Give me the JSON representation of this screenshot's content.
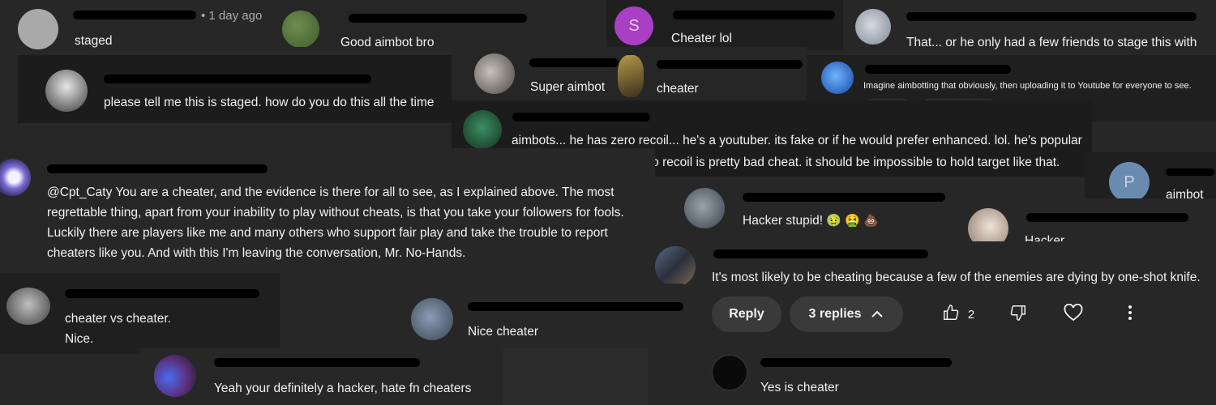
{
  "comments": [
    {
      "id": "c1",
      "meta": "• 1 day ago",
      "text": "staged"
    },
    {
      "id": "c2",
      "text": "Good aimbot bro"
    },
    {
      "id": "c3",
      "avatar_letter": "S",
      "text": "Cheater lol"
    },
    {
      "id": "c4",
      "text": "That... or he only had a few friends to stage this with"
    },
    {
      "id": "c5",
      "text": "please tell me this is staged. how do you do this all the time"
    },
    {
      "id": "c6",
      "text": "Super aimbot"
    },
    {
      "id": "c7",
      "text": "cheater"
    },
    {
      "id": "c8",
      "text": "Imagine aimbotting that obviously, then uploading it to Youtube for everyone to see."
    },
    {
      "id": "c9",
      "lines": [
        "aimbots...  he has zero recoil... he's a youtuber. its fake or if he would prefer enhanced. lol. he's popular",
        "with the algorythm but.. no recoil is pretty bad cheat. it should be impossible to hold target like that."
      ]
    },
    {
      "id": "c10",
      "lines": [
        "@Cpt_Caty You are a cheater, and the evidence is there for all to see, as I explained above. The most",
        "regrettable thing, apart from your inability to play without cheats, is that you take your followers for fools.",
        "Luckily there are players like me and many others who support fair play and take the trouble to report",
        "cheaters like you. And with this I'm leaving the conversation, Mr. No-Hands."
      ]
    },
    {
      "id": "c11",
      "avatar_letter": "P",
      "text": "aimbot"
    },
    {
      "id": "c12",
      "text": "Hacker stupid!",
      "emojis": [
        "🤢",
        "🤮",
        "💩"
      ]
    },
    {
      "id": "c13",
      "text": "Hacker"
    },
    {
      "id": "c14",
      "text": "It's most likely to be cheating because a few of the enemies are dying by one-shot knife."
    },
    {
      "id": "c15",
      "lines": [
        "cheater vs cheater.",
        "Nice."
      ]
    },
    {
      "id": "c16",
      "text": "Nice cheater"
    },
    {
      "id": "c17",
      "text": "Yeah your definitely a hacker, hate fn cheaters"
    },
    {
      "id": "c18",
      "text": "Yes is cheater"
    }
  ],
  "actions": {
    "reply_label": "Reply",
    "replies_label": "3 replies",
    "like_count": "2",
    "icons": [
      "thumbs-up-icon",
      "thumbs-down-icon",
      "heart-icon",
      "more-vertical-icon",
      "chevron-up-icon"
    ]
  },
  "colors": {
    "background": "#272727",
    "card_dark": "#212121",
    "card_mid": "#2a2a2a",
    "pill": "#3a3a3a",
    "text": "#f1f1f1",
    "meta": "#aaaaaa",
    "avatar_purple": "#a93fc2",
    "avatar_blue_grey": "#6a8bb0"
  }
}
